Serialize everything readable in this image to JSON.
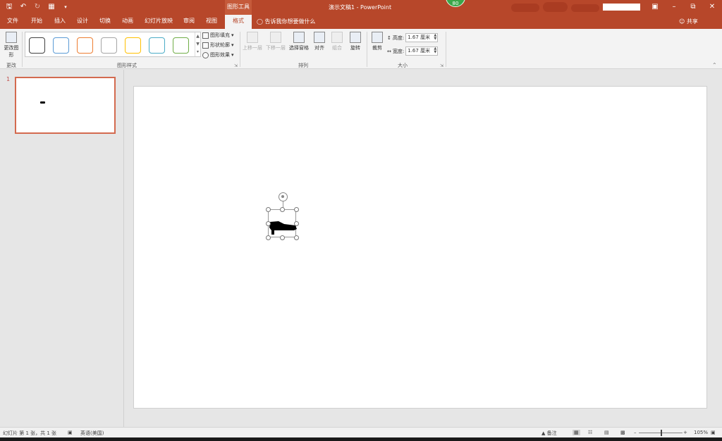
{
  "app": {
    "doc_title": "演示文稿1  -  PowerPoint",
    "context_tab_group": "图形工具",
    "user_badge": "80"
  },
  "qat": {
    "save_icon": "save-icon",
    "undo_icon": "undo-icon",
    "redo_icon": "redo-icon",
    "start_icon": "start-from-beginning-icon",
    "customize_icon": "customize-qat-icon"
  },
  "tabs": [
    {
      "label": "文件"
    },
    {
      "label": "开始"
    },
    {
      "label": "插入"
    },
    {
      "label": "设计"
    },
    {
      "label": "切换"
    },
    {
      "label": "动画"
    },
    {
      "label": "幻灯片放映"
    },
    {
      "label": "审阅"
    },
    {
      "label": "视图"
    },
    {
      "label": "格式",
      "active": true
    }
  ],
  "tell_me": "告诉我你想要做什么",
  "share": "共享",
  "ribbon": {
    "change_shape": {
      "label_line1": "更改图",
      "label_line2": "形",
      "group": "更改"
    },
    "shape_styles": {
      "group": "图形样式",
      "swatch_colors": [
        "#404040",
        "#5b9bd5",
        "#ed7d31",
        "#a5a5a5",
        "#ffc000",
        "#4bacc6",
        "#70ad47"
      ],
      "fill": "图形填充",
      "outline": "形状轮廓",
      "effects": "图形效果"
    },
    "arrange": {
      "group": "排列",
      "bring_forward": "上移一层",
      "send_backward": "下移一层",
      "selection_pane": "选择窗格",
      "align": "对齐",
      "group_btn": "组合",
      "rotate": "旋转"
    },
    "size": {
      "group": "大小",
      "crop": "裁剪",
      "height_label": "高度:",
      "height_value": "1.67 厘米",
      "width_label": "宽度:",
      "width_value": "1.67 厘米"
    }
  },
  "thumbnails": [
    {
      "number": "1"
    }
  ],
  "status": {
    "slide_info": "幻灯片 第 1 张，共 1 张",
    "language": "英语(美国)",
    "notes": "备注",
    "zoom": "105%"
  }
}
